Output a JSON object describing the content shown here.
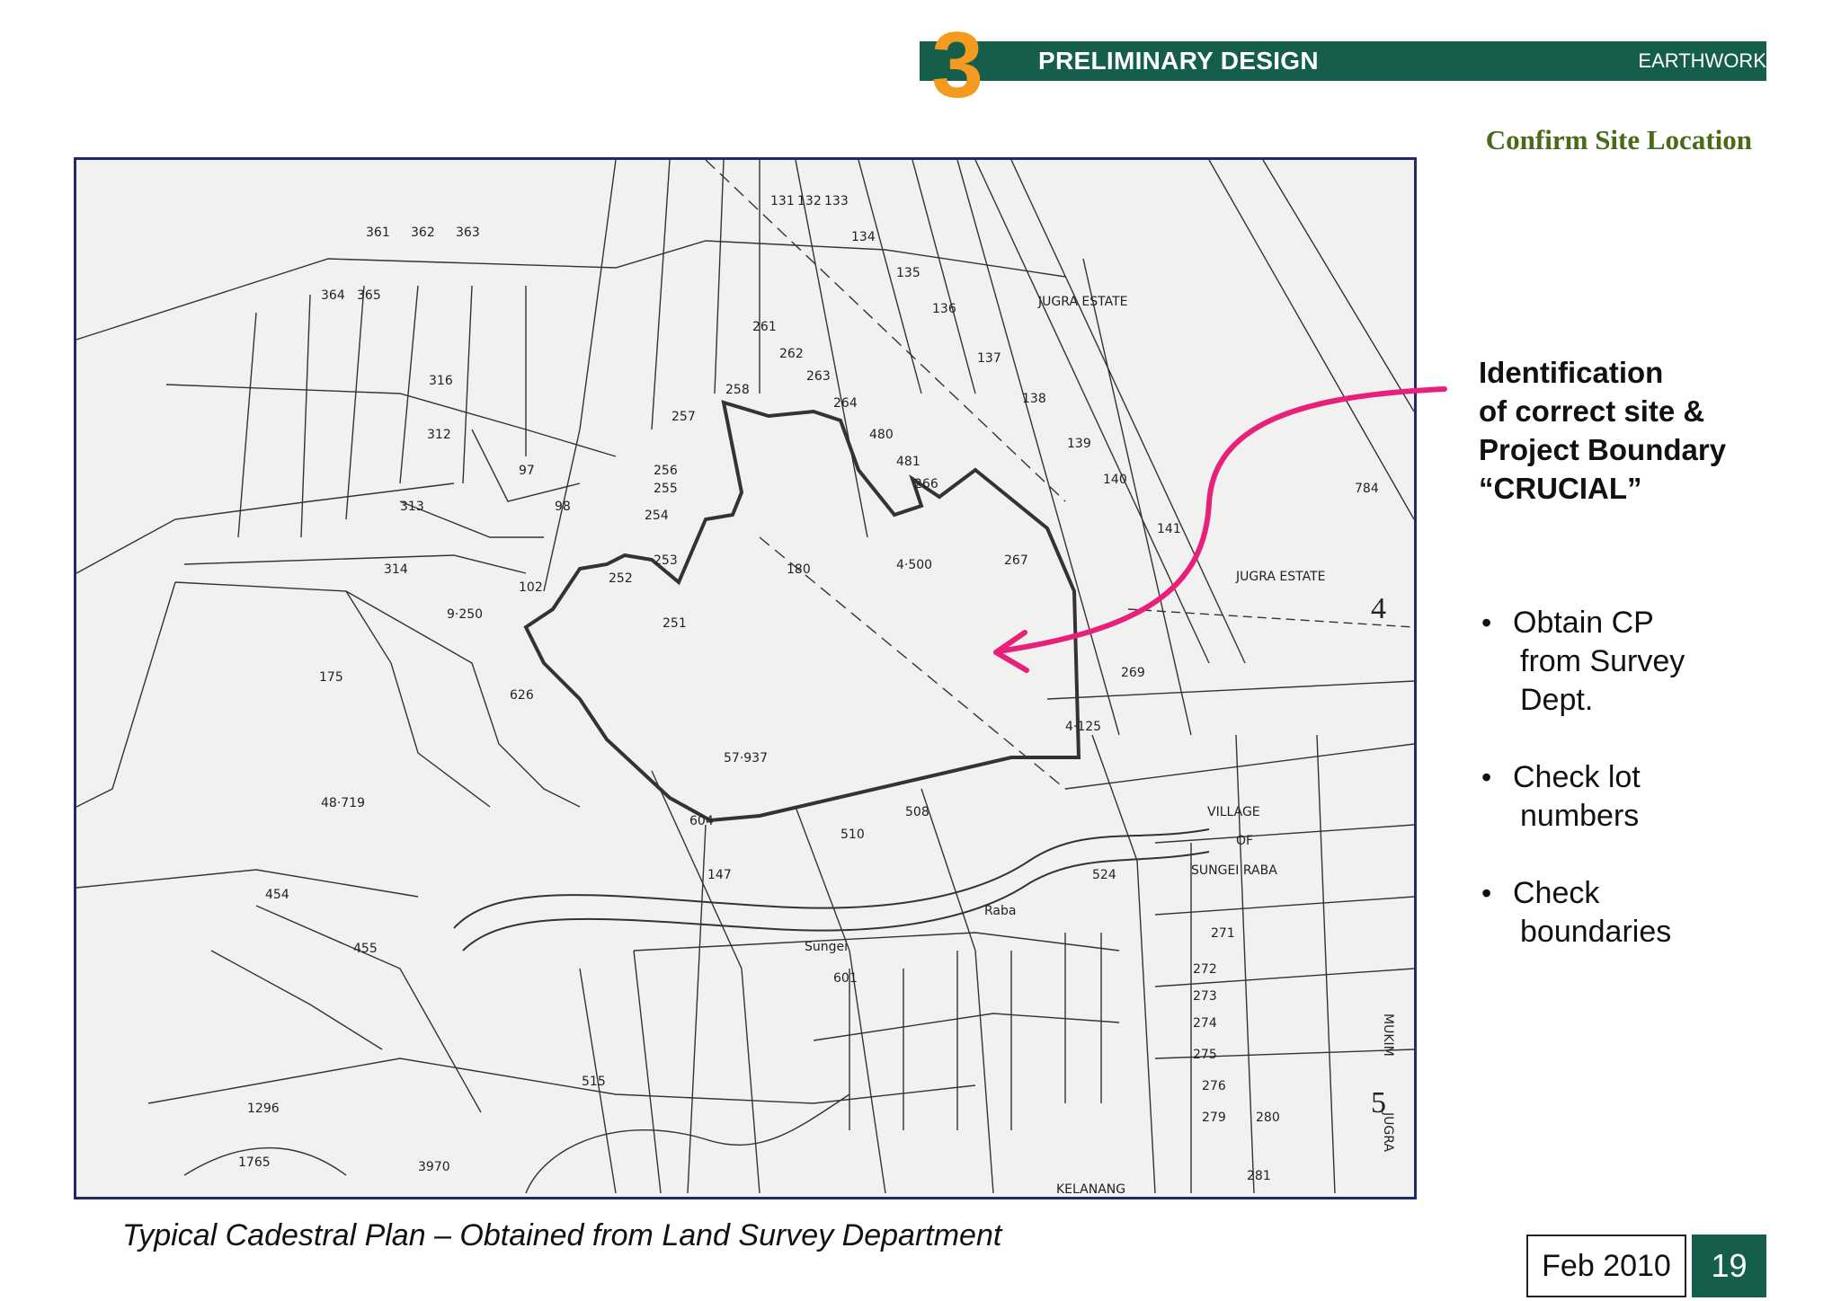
{
  "header": {
    "section_number": "3",
    "title": "PRELIMINARY DESIGN",
    "tag": "EARTHWORK",
    "bar_color": "#155e4c",
    "number_color": "#f39a1f"
  },
  "subtitle": "Confirm Site Location",
  "plan": {
    "labels": {
      "jugra_estate_1": "JUGRA ESTATE",
      "jugra_estate_2": "JUGRA ESTATE",
      "village": "VILLAGE",
      "of": "OF",
      "sungei_raba": "SUNGEI RABA",
      "sungei": "Sungei",
      "raba": "Raba",
      "mukim": "MUKIM",
      "jugra": "JUGRA",
      "kelanang": "KELANANG",
      "lot_180": "180",
      "lot_175": "175",
      "lot_454": "454",
      "lot_455": "455",
      "lot_137": "137",
      "lot_141": "141",
      "lot_147": "147",
      "lot_251": "251",
      "lot_252": "252",
      "lot_253": "253",
      "lot_254": "254",
      "lot_255": "255",
      "lot_256": "256",
      "lot_257": "257",
      "lot_258": "258",
      "lot_261": "261",
      "lot_262": "262",
      "lot_263": "263",
      "lot_264": "264",
      "lot_266": "266",
      "lot_267": "267",
      "lot_269": "269",
      "lot_271": "271",
      "lot_272": "272",
      "lot_273": "273",
      "lot_274": "274",
      "lot_275": "275",
      "lot_276": "276",
      "lot_279": "279",
      "lot_280": "280",
      "lot_281": "281",
      "lot_312": "312",
      "lot_313": "313",
      "lot_314": "314",
      "lot_316": "316",
      "lot_361": "361",
      "lot_362": "362",
      "lot_363": "363",
      "lot_364": "364",
      "lot_365": "365",
      "lot_508": "508",
      "lot_510": "510",
      "lot_515": "515",
      "lot_524": "524",
      "lot_604": "604",
      "lot_601": "601",
      "lot_626": "626",
      "lot_784": "784",
      "lot_131": "131",
      "lot_132": "132",
      "lot_133": "133",
      "lot_134": "134",
      "lot_135": "135",
      "lot_136": "136",
      "lot_138": "138",
      "lot_139": "139",
      "lot_140": "140",
      "lot_480": "480",
      "lot_481": "481",
      "lot_97": "97",
      "lot_98": "98",
      "lot_102": "102",
      "lot_1296": "1296",
      "lot_1765": "1765",
      "lot_3970": "3970",
      "lot_4": "4",
      "lot_5": "5",
      "area_57937": "57·937",
      "area_4500": "4·500",
      "area_9250": "9·250",
      "area_48719": "48·719",
      "area_4125": "4·125"
    }
  },
  "callout": {
    "line1": "Identification",
    "line2": "of correct site &",
    "line3": "Project Boundary",
    "line4": "“CRUCIAL”"
  },
  "bullets": [
    {
      "line1": "Obtain CP",
      "line2": "from Survey",
      "line3": "Dept."
    },
    {
      "line1": "Check lot",
      "line2": "numbers"
    },
    {
      "line1": "Check",
      "line2": "boundaries"
    }
  ],
  "bullet_symbol": "•",
  "caption": "Typical Cadestral Plan – Obtained from Land Survey Department",
  "footer": {
    "date": "Feb 2010",
    "page": "19"
  },
  "colors": {
    "arrow": "#e8207a",
    "frame": "#1e2a6a",
    "subtitle": "#4a6a18"
  }
}
